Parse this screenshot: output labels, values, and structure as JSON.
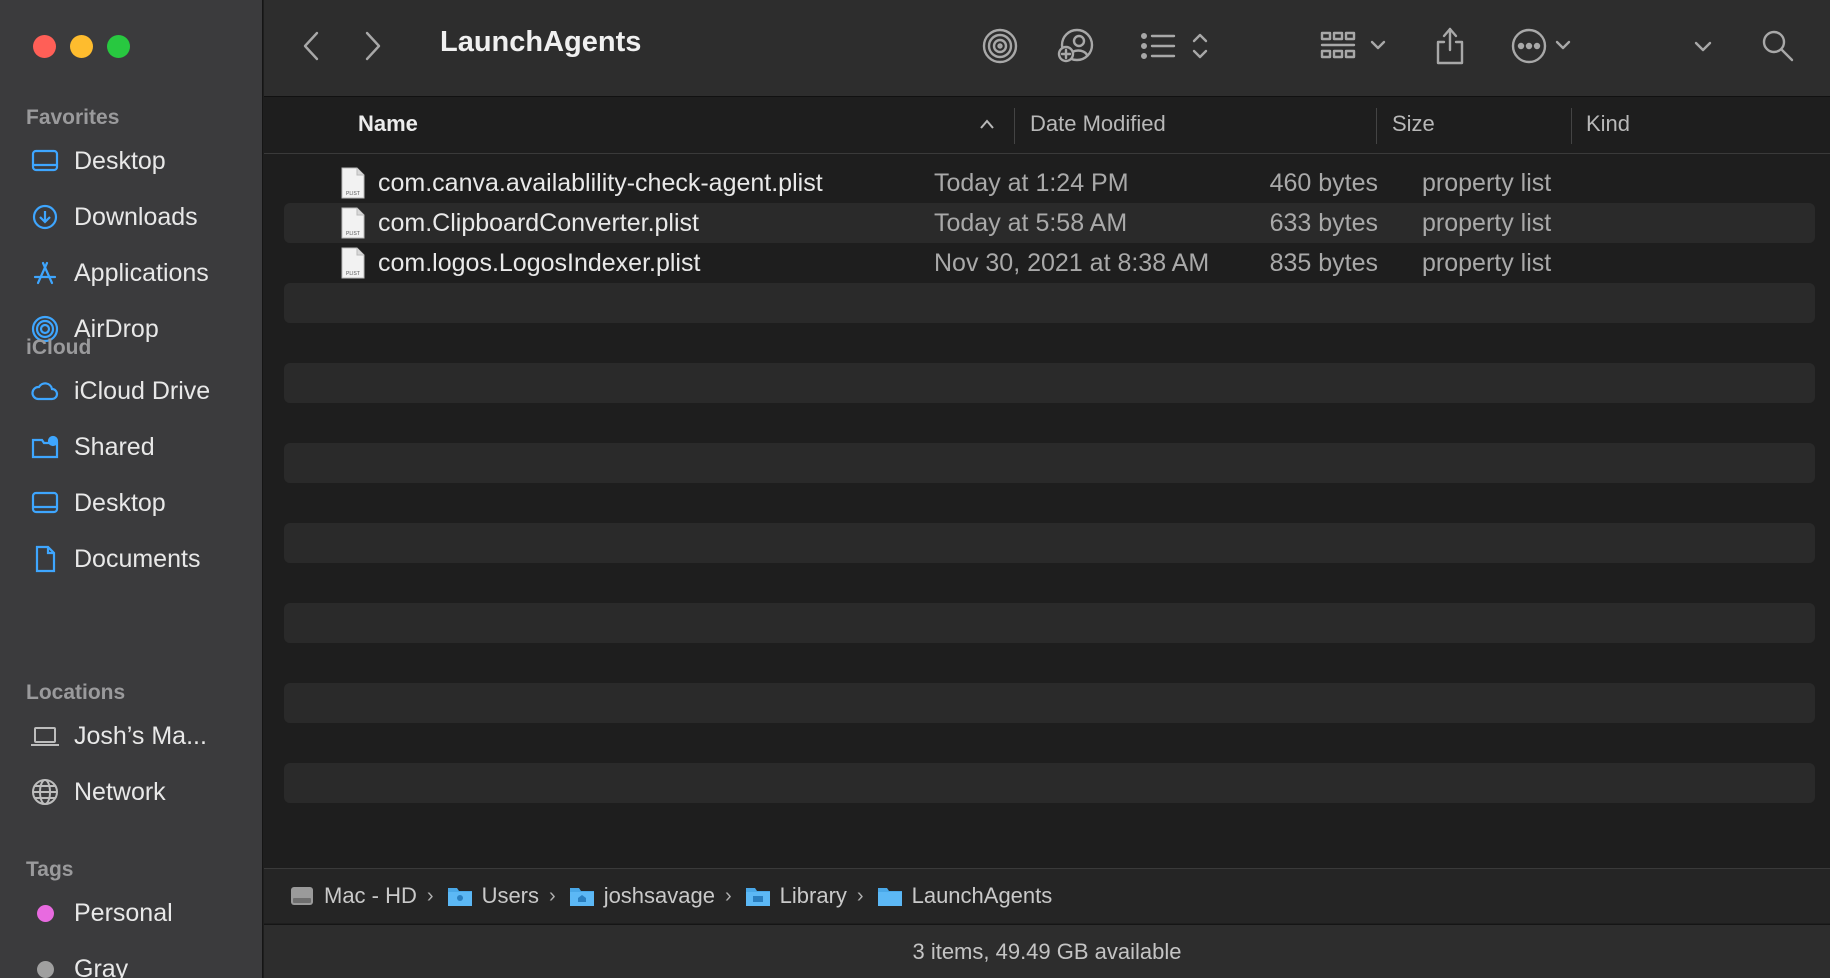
{
  "window": {
    "title": "LaunchAgents"
  },
  "sidebar": {
    "favorites": {
      "heading": "Favorites",
      "items": [
        {
          "label": "Desktop",
          "icon": "desktop-icon"
        },
        {
          "label": "Downloads",
          "icon": "downloads-icon"
        },
        {
          "label": "Applications",
          "icon": "applications-icon"
        },
        {
          "label": "AirDrop",
          "icon": "airdrop-icon"
        }
      ]
    },
    "icloud": {
      "heading": "iCloud",
      "items": [
        {
          "label": "iCloud Drive",
          "icon": "cloud-icon"
        },
        {
          "label": "Shared",
          "icon": "shared-folder-icon"
        },
        {
          "label": "Desktop",
          "icon": "desktop-icon"
        },
        {
          "label": "Documents",
          "icon": "document-icon"
        }
      ]
    },
    "locations": {
      "heading": "Locations",
      "items": [
        {
          "label": "Josh’s Ma...",
          "icon": "laptop-icon"
        },
        {
          "label": "Network",
          "icon": "globe-icon"
        }
      ]
    },
    "tags": {
      "heading": "Tags",
      "items": [
        {
          "label": "Personal",
          "color": "#e86ae0"
        },
        {
          "label": "Gray",
          "color": "#a0a0a0"
        }
      ]
    }
  },
  "columns": {
    "name": "Name",
    "date": "Date Modified",
    "size": "Size",
    "kind": "Kind"
  },
  "files": [
    {
      "name": "com.canva.availablility-check-agent.plist",
      "date": "Today at 1:24 PM",
      "size": "460 bytes",
      "kind": "property list",
      "icon_text": "PLIST"
    },
    {
      "name": "com.ClipboardConverter.plist",
      "date": "Today at 5:58 AM",
      "size": "633 bytes",
      "kind": "property list",
      "icon_text": "PLIST"
    },
    {
      "name": "com.logos.LogosIndexer.plist",
      "date": "Nov 30, 2021 at 8:38 AM",
      "size": "835 bytes",
      "kind": "property list",
      "icon_text": "PLIST"
    }
  ],
  "path": [
    {
      "label": "Mac - HD",
      "icon": "hard-drive-icon"
    },
    {
      "label": "Users",
      "icon": "users-folder-icon"
    },
    {
      "label": "joshsavage",
      "icon": "home-folder-icon"
    },
    {
      "label": "Library",
      "icon": "library-folder-icon"
    },
    {
      "label": "LaunchAgents",
      "icon": "folder-icon"
    }
  ],
  "path_separator": "›",
  "status": "3 items, 49.49 GB available",
  "colors": {
    "accent": "#3ea6ff",
    "sidebar_bg": "#3b3b3d",
    "window_bg": "#1e1e1e"
  }
}
